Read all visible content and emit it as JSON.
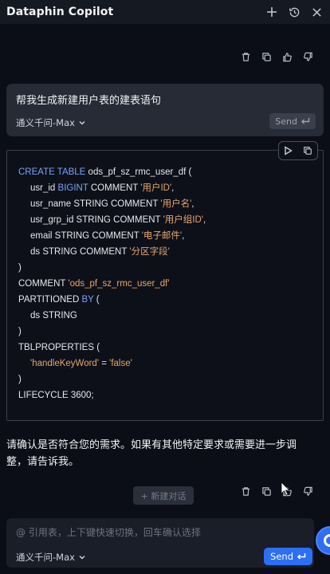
{
  "header": {
    "title": "Dataphin Copilot",
    "icons": [
      "plus-icon",
      "history-icon",
      "close-icon"
    ]
  },
  "message_actions": [
    "delete-icon",
    "copy-icon",
    "thumbs-up-icon",
    "thumbs-down-icon"
  ],
  "user_message": {
    "text": "帮我生成新建用户表的建表语句",
    "model": "通义千问-Max",
    "send_label": "Send"
  },
  "code_block": {
    "tools": [
      "run-icon",
      "copy-icon"
    ],
    "lines": [
      {
        "indent": 0,
        "parts": [
          {
            "t": "CREATE TABLE",
            "c": "kw"
          },
          {
            "t": " ods_pf_sz_rmc_user_df (",
            "c": ""
          }
        ]
      },
      {
        "indent": 1,
        "parts": [
          {
            "t": "usr_id ",
            "c": ""
          },
          {
            "t": "BIGINT",
            "c": "kw"
          },
          {
            "t": " COMMENT ",
            "c": ""
          },
          {
            "t": "'用户ID'",
            "c": "str"
          },
          {
            "t": ",",
            "c": ""
          }
        ]
      },
      {
        "indent": 1,
        "parts": [
          {
            "t": "usr_name STRING COMMENT ",
            "c": ""
          },
          {
            "t": "'用户名'",
            "c": "str"
          },
          {
            "t": ",",
            "c": ""
          }
        ]
      },
      {
        "indent": 1,
        "parts": [
          {
            "t": "usr_grp_id STRING COMMENT ",
            "c": ""
          },
          {
            "t": "'用户组ID'",
            "c": "str"
          },
          {
            "t": ",",
            "c": ""
          }
        ]
      },
      {
        "indent": 1,
        "parts": [
          {
            "t": "email STRING COMMENT ",
            "c": ""
          },
          {
            "t": "'电子邮件'",
            "c": "str"
          },
          {
            "t": ",",
            "c": ""
          }
        ]
      },
      {
        "indent": 1,
        "parts": [
          {
            "t": "ds STRING COMMENT ",
            "c": ""
          },
          {
            "t": "'分区字段'",
            "c": "str"
          }
        ]
      },
      {
        "indent": 0,
        "parts": [
          {
            "t": ")",
            "c": ""
          }
        ]
      },
      {
        "indent": 0,
        "parts": [
          {
            "t": "COMMENT ",
            "c": ""
          },
          {
            "t": "'ods_pf_sz_rmc_user_df'",
            "c": "str"
          }
        ]
      },
      {
        "indent": 0,
        "parts": [
          {
            "t": "PARTITIONED ",
            "c": ""
          },
          {
            "t": "BY",
            "c": "kw"
          },
          {
            "t": " (",
            "c": ""
          }
        ]
      },
      {
        "indent": 1,
        "parts": [
          {
            "t": "ds STRING",
            "c": ""
          }
        ]
      },
      {
        "indent": 0,
        "parts": [
          {
            "t": ")",
            "c": ""
          }
        ]
      },
      {
        "indent": 0,
        "parts": [
          {
            "t": "TBLPROPERTIES (",
            "c": ""
          }
        ]
      },
      {
        "indent": 1,
        "parts": [
          {
            "t": "'handleKeyWord'",
            "c": "str"
          },
          {
            "t": " = ",
            "c": ""
          },
          {
            "t": "'false'",
            "c": "str"
          }
        ]
      },
      {
        "indent": 0,
        "parts": [
          {
            "t": ")",
            "c": ""
          }
        ]
      },
      {
        "indent": 0,
        "parts": [
          {
            "t": "LIFECYCLE 3600;",
            "c": ""
          }
        ]
      }
    ]
  },
  "assistant_reply": {
    "line1": "请确认是否符合您的需求。如果有其他特定要求或需要进一步调",
    "line2": "整，请告诉我。"
  },
  "new_chat_label": "+ 新建对话",
  "composer": {
    "placeholder": "@ 引用表，上下键快速切换，回车确认选择",
    "model": "通义千问-Max",
    "send_label": "Send"
  },
  "colors": {
    "accent": "#2c6ff5",
    "keyword": "#7aa2f7",
    "string": "#e6a66a"
  }
}
